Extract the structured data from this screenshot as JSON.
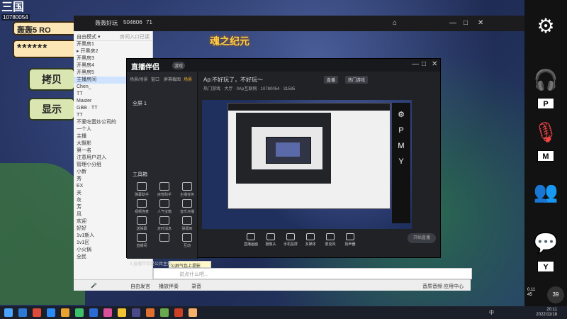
{
  "game": {
    "logo": "三国",
    "logo_id": "10780054",
    "room_label": "轰轰5 RO",
    "password": "******",
    "copy_button": "拷贝",
    "show_button": "显示",
    "title_art": "魂之纪元"
  },
  "right_panel": {
    "key_p": "P",
    "key_m": "M",
    "key_y": "Y"
  },
  "outer_window": {
    "channel": "轰轰好玩",
    "room_no": "504606",
    "viewers": "71"
  },
  "chat": {
    "header_left": "自由模式 ▾",
    "header_right": "房间入口已读",
    "rows": [
      "开黑房1",
      "▸ 开黑房2",
      "开黑房3",
      "开黑房4",
      "开黑房5",
      "主播房间",
      "Chen_",
      "TT",
      "Master",
      "GBB · TT",
      "TT",
      "不爱吃蛋炒公司的",
      "一个人",
      "主播",
      "大飘影",
      "第一名",
      "注意用户进入",
      "管理小分组",
      "小新",
      "秀",
      "EX",
      "关",
      "灰",
      "芳",
      "风",
      "欢迎",
      "好好",
      "1v1新人",
      "1v1区",
      "小火锅",
      "全民"
    ],
    "notice": "公屏气色上提影",
    "input_placeholder": "说点什么吧...",
    "footer_free": "自由发言",
    "footer_music": "播放伴奏",
    "footer_record": "录音",
    "footer_audio": "音质音频",
    "footer_app": "应用中心"
  },
  "app": {
    "brand": "直播伴侣",
    "tag": "游戏",
    "nav_tabs": [
      "场景/场景",
      "窗口",
      "屏幕截图",
      "场景"
    ],
    "room_title": "Ap:不好玩了，不好玩～",
    "pills": [
      "直播",
      "热门游戏"
    ],
    "sub": "热门游戏 · 大厅 · 0Ap互联网 · 10780054 · 31585",
    "scene": "全屏 1",
    "tools_title": "工具箱",
    "tools": [
      "弹幕助手",
      "房管助手",
      "主播任务",
      "视频连麦",
      "人气宝箱",
      "音乐点播",
      "送弹幕",
      "定时消息",
      "弹幕库",
      "直播间",
      "",
      "互动"
    ],
    "bottom_note": "3.直播伴侣是公共主播",
    "ctrls": [
      "直播画面",
      "摄像头",
      "手机投屏",
      "多媒体",
      "麦克风",
      "扬声器"
    ],
    "start": "开始直播",
    "preview_side": [
      "⚙",
      "P",
      "M",
      "Y"
    ]
  },
  "taskbar": {
    "time": "20:11",
    "date": "2022/11/18",
    "tray": "中"
  },
  "overlay": {
    "speed_up": "0.11",
    "speed_down": "45",
    "volume": "39"
  }
}
